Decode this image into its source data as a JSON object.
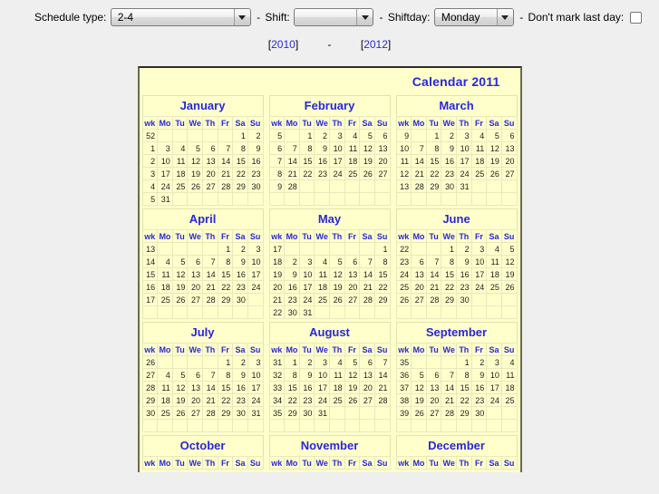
{
  "toolbar": {
    "schedule_label": "Schedule type:",
    "schedule_value": "2-4",
    "sep1": "-",
    "shift_label": "Shift:",
    "shift_value": "",
    "sep2": "-",
    "shiftday_label": "Shiftday:",
    "shiftday_value": "Monday",
    "sep3": "-",
    "dontmark_label": "Don't mark last day:",
    "dontmark_checked": false
  },
  "yearnav": {
    "prev_open": "[",
    "prev_year": "2010",
    "prev_close": "]",
    "dash": "-",
    "next_open": "[",
    "next_year": "2012",
    "next_close": "]"
  },
  "calendar": {
    "title": "Calendar 2011",
    "weekday_headers": [
      "wk",
      "Mo",
      "Tu",
      "We",
      "Th",
      "Fr",
      "Sa",
      "Su"
    ],
    "colors": {
      "page_background": "#efefef",
      "calendar_background": "#ffffcc",
      "heading_blue": "#2828d8",
      "week_number_blue": "#2f6fe0",
      "marked_red": "#ff2200",
      "day_text": "#1a1a1a",
      "cell_border": "#e8e8bc"
    },
    "months": [
      {
        "name": "January",
        "rows": [
          {
            "wk": "52",
            "days": [
              "",
              "",
              "",
              "",
              "",
              "1",
              "2"
            ],
            "red": [
              5,
              6
            ]
          },
          {
            "wk": "1",
            "days": [
              "3",
              "4",
              "5",
              "6",
              "7",
              "8",
              "9"
            ],
            "red": [
              6
            ]
          },
          {
            "wk": "2",
            "days": [
              "10",
              "11",
              "12",
              "13",
              "14",
              "15",
              "16"
            ],
            "red": [
              6
            ]
          },
          {
            "wk": "3",
            "days": [
              "17",
              "18",
              "19",
              "20",
              "21",
              "22",
              "23"
            ],
            "red": [
              6
            ]
          },
          {
            "wk": "4",
            "days": [
              "24",
              "25",
              "26",
              "27",
              "28",
              "29",
              "30"
            ],
            "red": [
              6
            ]
          },
          {
            "wk": "5",
            "days": [
              "31",
              "",
              "",
              "",
              "",
              "",
              ""
            ],
            "red": []
          }
        ]
      },
      {
        "name": "February",
        "rows": [
          {
            "wk": "5",
            "days": [
              "",
              "1",
              "2",
              "3",
              "4",
              "5",
              "6"
            ],
            "red": [
              6
            ]
          },
          {
            "wk": "6",
            "days": [
              "7",
              "8",
              "9",
              "10",
              "11",
              "12",
              "13"
            ],
            "red": [
              6
            ]
          },
          {
            "wk": "7",
            "days": [
              "14",
              "15",
              "16",
              "17",
              "18",
              "19",
              "20"
            ],
            "red": [
              6
            ]
          },
          {
            "wk": "8",
            "days": [
              "21",
              "22",
              "23",
              "24",
              "25",
              "26",
              "27"
            ],
            "red": [
              6
            ]
          },
          {
            "wk": "9",
            "days": [
              "28",
              "",
              "",
              "",
              "",
              "",
              ""
            ],
            "red": []
          },
          {
            "wk": "",
            "days": [
              "",
              "",
              "",
              "",
              "",
              "",
              ""
            ],
            "red": []
          }
        ]
      },
      {
        "name": "March",
        "rows": [
          {
            "wk": "9",
            "days": [
              "",
              "1",
              "2",
              "3",
              "4",
              "5",
              "6"
            ],
            "red": [
              6
            ]
          },
          {
            "wk": "10",
            "days": [
              "7",
              "8",
              "9",
              "10",
              "11",
              "12",
              "13"
            ],
            "red": [
              6
            ]
          },
          {
            "wk": "11",
            "days": [
              "14",
              "15",
              "16",
              "17",
              "18",
              "19",
              "20"
            ],
            "red": [
              6
            ]
          },
          {
            "wk": "12",
            "days": [
              "21",
              "22",
              "23",
              "24",
              "25",
              "26",
              "27"
            ],
            "red": [
              6
            ]
          },
          {
            "wk": "13",
            "days": [
              "28",
              "29",
              "30",
              "31",
              "",
              "",
              ""
            ],
            "red": [
              0
            ]
          },
          {
            "wk": "",
            "days": [
              "",
              "",
              "",
              "",
              "",
              "",
              ""
            ],
            "red": []
          }
        ]
      },
      {
        "name": "April",
        "rows": [
          {
            "wk": "13",
            "days": [
              "",
              "",
              "",
              "",
              "1",
              "2",
              "3"
            ],
            "red": [
              6
            ]
          },
          {
            "wk": "14",
            "days": [
              "4",
              "5",
              "6",
              "7",
              "8",
              "9",
              "10"
            ],
            "red": [
              6
            ]
          },
          {
            "wk": "15",
            "days": [
              "11",
              "12",
              "13",
              "14",
              "15",
              "16",
              "17"
            ],
            "red": [
              6
            ]
          },
          {
            "wk": "16",
            "days": [
              "18",
              "19",
              "20",
              "21",
              "22",
              "23",
              "24"
            ],
            "red": [
              4,
              6
            ]
          },
          {
            "wk": "17",
            "days": [
              "25",
              "26",
              "27",
              "28",
              "29",
              "30",
              ""
            ],
            "red": [
              0
            ]
          },
          {
            "wk": "",
            "days": [
              "",
              "",
              "",
              "",
              "",
              "",
              ""
            ],
            "red": []
          }
        ]
      },
      {
        "name": "May",
        "rows": [
          {
            "wk": "17",
            "days": [
              "",
              "",
              "",
              "",
              "",
              "",
              "1"
            ],
            "red": [
              6
            ]
          },
          {
            "wk": "18",
            "days": [
              "2",
              "3",
              "4",
              "5",
              "6",
              "7",
              "8"
            ],
            "red": [
              3,
              6
            ]
          },
          {
            "wk": "19",
            "days": [
              "9",
              "10",
              "11",
              "12",
              "13",
              "14",
              "15"
            ],
            "red": [
              6
            ]
          },
          {
            "wk": "20",
            "days": [
              "16",
              "17",
              "18",
              "19",
              "20",
              "21",
              "22"
            ],
            "red": [
              6
            ]
          },
          {
            "wk": "21",
            "days": [
              "23",
              "24",
              "25",
              "26",
              "27",
              "28",
              "29"
            ],
            "red": [
              3,
              6
            ]
          },
          {
            "wk": "22",
            "days": [
              "30",
              "31",
              "",
              "",
              "",
              "",
              ""
            ],
            "red": []
          }
        ]
      },
      {
        "name": "June",
        "rows": [
          {
            "wk": "22",
            "days": [
              "",
              "",
              "1",
              "2",
              "3",
              "4",
              "5"
            ],
            "red": [
              3,
              6
            ]
          },
          {
            "wk": "23",
            "days": [
              "6",
              "7",
              "8",
              "9",
              "10",
              "11",
              "12"
            ],
            "red": [
              6
            ]
          },
          {
            "wk": "24",
            "days": [
              "13",
              "14",
              "15",
              "16",
              "17",
              "18",
              "19"
            ],
            "red": [
              0,
              6
            ]
          },
          {
            "wk": "25",
            "days": [
              "20",
              "21",
              "22",
              "23",
              "24",
              "25",
              "26"
            ],
            "red": [
              6
            ]
          },
          {
            "wk": "26",
            "days": [
              "27",
              "28",
              "29",
              "30",
              "",
              "",
              ""
            ],
            "red": []
          },
          {
            "wk": "",
            "days": [
              "",
              "",
              "",
              "",
              "",
              "",
              ""
            ],
            "red": []
          }
        ]
      },
      {
        "name": "July",
        "rows": [
          {
            "wk": "26",
            "days": [
              "",
              "",
              "",
              "",
              "1",
              "2",
              "3"
            ],
            "red": [
              6
            ]
          },
          {
            "wk": "27",
            "days": [
              "4",
              "5",
              "6",
              "7",
              "8",
              "9",
              "10"
            ],
            "red": [
              6
            ]
          },
          {
            "wk": "28",
            "days": [
              "11",
              "12",
              "13",
              "14",
              "15",
              "16",
              "17"
            ],
            "red": [
              6
            ]
          },
          {
            "wk": "29",
            "days": [
              "18",
              "19",
              "20",
              "21",
              "22",
              "23",
              "24"
            ],
            "red": [
              6
            ]
          },
          {
            "wk": "30",
            "days": [
              "25",
              "26",
              "27",
              "28",
              "29",
              "30",
              "31"
            ],
            "red": [
              6
            ]
          },
          {
            "wk": "",
            "days": [
              "",
              "",
              "",
              "",
              "",
              "",
              ""
            ],
            "red": []
          }
        ]
      },
      {
        "name": "August",
        "rows": [
          {
            "wk": "31",
            "days": [
              "1",
              "2",
              "3",
              "4",
              "5",
              "6",
              "7"
            ],
            "red": [
              6
            ]
          },
          {
            "wk": "32",
            "days": [
              "8",
              "9",
              "10",
              "11",
              "12",
              "13",
              "14"
            ],
            "red": [
              6
            ]
          },
          {
            "wk": "33",
            "days": [
              "15",
              "16",
              "17",
              "18",
              "19",
              "20",
              "21"
            ],
            "red": [
              6
            ]
          },
          {
            "wk": "34",
            "days": [
              "22",
              "23",
              "24",
              "25",
              "26",
              "27",
              "28"
            ],
            "red": [
              6
            ]
          },
          {
            "wk": "35",
            "days": [
              "29",
              "30",
              "31",
              "",
              "",
              "",
              ""
            ],
            "red": []
          },
          {
            "wk": "",
            "days": [
              "",
              "",
              "",
              "",
              "",
              "",
              ""
            ],
            "red": []
          }
        ]
      },
      {
        "name": "September",
        "rows": [
          {
            "wk": "35",
            "days": [
              "",
              "",
              "",
              "1",
              "2",
              "3",
              "4"
            ],
            "red": [
              6
            ]
          },
          {
            "wk": "36",
            "days": [
              "5",
              "6",
              "7",
              "8",
              "9",
              "10",
              "11"
            ],
            "red": [
              6
            ]
          },
          {
            "wk": "37",
            "days": [
              "12",
              "13",
              "14",
              "15",
              "16",
              "17",
              "18"
            ],
            "red": [
              6
            ]
          },
          {
            "wk": "38",
            "days": [
              "19",
              "20",
              "21",
              "22",
              "23",
              "24",
              "25"
            ],
            "red": [
              6
            ]
          },
          {
            "wk": "39",
            "days": [
              "26",
              "27",
              "28",
              "29",
              "30",
              "",
              ""
            ],
            "red": []
          },
          {
            "wk": "",
            "days": [
              "",
              "",
              "",
              "",
              "",
              "",
              ""
            ],
            "red": []
          }
        ]
      },
      {
        "name": "October",
        "rows": []
      },
      {
        "name": "November",
        "rows": []
      },
      {
        "name": "December",
        "rows": []
      }
    ]
  }
}
